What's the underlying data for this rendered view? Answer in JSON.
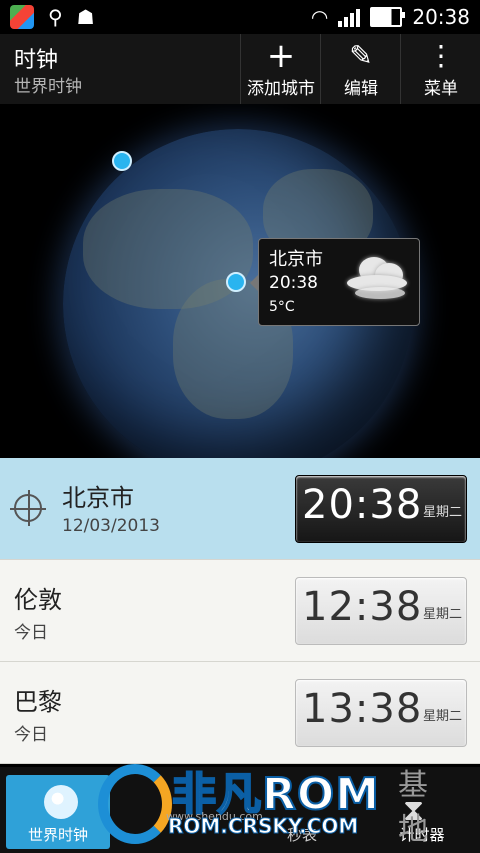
{
  "status_bar": {
    "time": "20:38"
  },
  "action_bar": {
    "title": "时钟",
    "subtitle": "世界时钟",
    "add_city_label": "添加城市",
    "edit_label": "编辑",
    "menu_label": "菜单"
  },
  "map": {
    "popup": {
      "city": "北京市",
      "time": "20:38",
      "temp": "5°C",
      "weather_icon": "cloudy-night-icon"
    }
  },
  "cities": [
    {
      "name": "北京市",
      "sub": "12/03/2013",
      "time": "20:38",
      "weekday": "星期二"
    },
    {
      "name": "伦敦",
      "sub": "今日",
      "time": "12:38",
      "weekday": "星期二"
    },
    {
      "name": "巴黎",
      "sub": "今日",
      "time": "13:38",
      "weekday": "星期二"
    }
  ],
  "tabs": {
    "world_clock": "世界时钟",
    "timer": "计时器",
    "middle_partial": "秒表"
  },
  "watermark": {
    "brand": "非凡ROM",
    "url": "ROM.CRSKY.COM",
    "small": "www.shendu.com",
    "grey": "基地"
  },
  "colors": {
    "selected_row": "#b9dfee",
    "active_tab": "#2fa1d8",
    "pin": "#2ab4ef"
  }
}
